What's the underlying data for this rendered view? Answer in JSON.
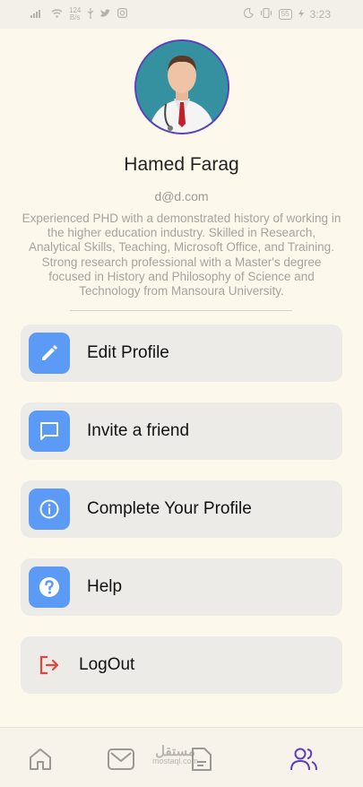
{
  "status_bar": {
    "net_speed_value": "124",
    "net_speed_unit": "B/s",
    "battery": "55",
    "time": "3:23"
  },
  "profile": {
    "name": "Hamed Farag",
    "email": "d@d.com",
    "bio": "Experienced PHD with a demonstrated history of working in the higher education industry. Skilled in Research, Analytical Skills, Teaching, Microsoft Office, and Training. Strong research professional with a Master's degree focused in History and Philosophy of Science and Technology from Mansoura University."
  },
  "menu": {
    "edit_profile": "Edit Profile",
    "invite_friend": "Invite a friend",
    "complete_profile": "Complete Your Profile",
    "help": "Help",
    "logout": "LogOut"
  },
  "watermark": {
    "main": "مستقل",
    "sub": "mostaql.com"
  },
  "colors": {
    "background": "#fdf8ec",
    "accent_blue": "#5b9bf5",
    "logout_red": "#e0463c",
    "active_nav": "#5b3fbf"
  }
}
